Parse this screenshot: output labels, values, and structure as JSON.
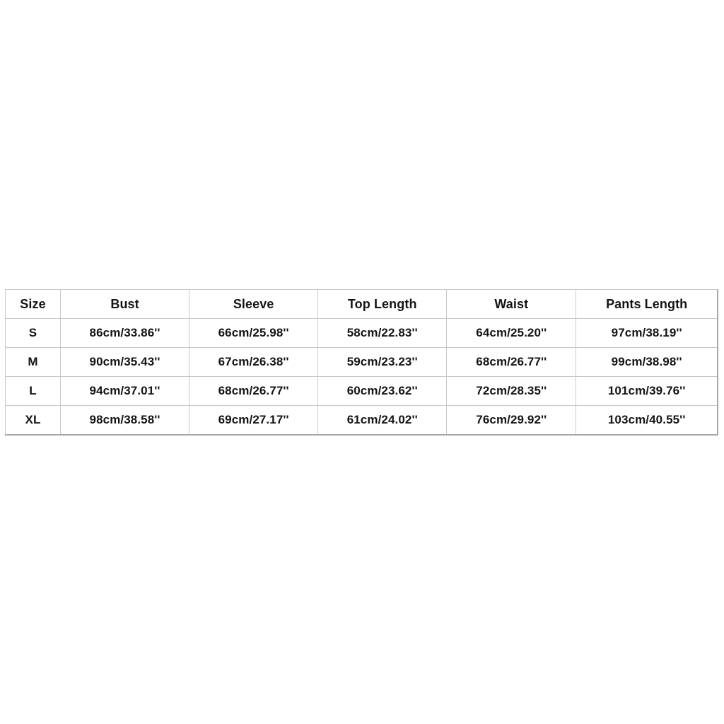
{
  "size_chart": {
    "headers": [
      "Size",
      "Bust",
      "Sleeve",
      "Top Length",
      "Waist",
      "Pants Length"
    ],
    "rows": [
      [
        "S",
        "86cm/33.86''",
        "66cm/25.98''",
        "58cm/22.83''",
        "64cm/25.20''",
        "97cm/38.19''"
      ],
      [
        "M",
        "90cm/35.43''",
        "67cm/26.38''",
        "59cm/23.23''",
        "68cm/26.77''",
        "99cm/38.98''"
      ],
      [
        "L",
        "94cm/37.01''",
        "68cm/26.77''",
        "60cm/23.62''",
        "72cm/28.35''",
        "101cm/39.76''"
      ],
      [
        "XL",
        "98cm/38.58''",
        "69cm/27.17''",
        "61cm/24.02''",
        "76cm/29.92''",
        "103cm/40.55''"
      ]
    ]
  }
}
